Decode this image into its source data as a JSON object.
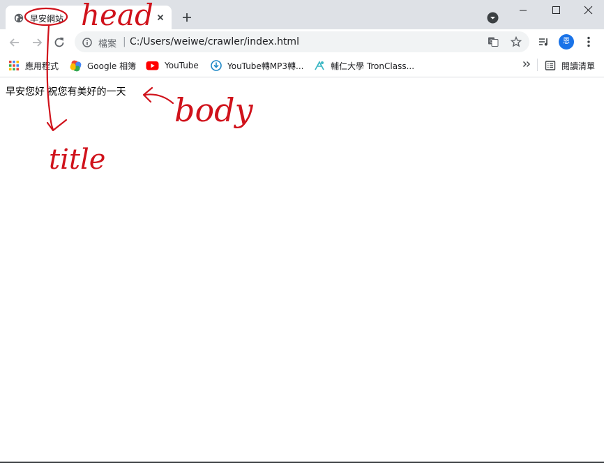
{
  "browser": {
    "tab": {
      "title": "早安網站",
      "favicon": "globe-icon"
    },
    "omnibox": {
      "scheme_label": "檔案",
      "url": "C:/Users/weiwe/crawler/index.html"
    },
    "profile": {
      "initial": "恩"
    },
    "bookmarks": [
      {
        "label": "應用程式",
        "icon": "apps-grid-icon"
      },
      {
        "label": "Google 相簿",
        "icon": "google-photos-icon"
      },
      {
        "label": "YouTube",
        "icon": "youtube-icon"
      },
      {
        "label": "YouTube轉MP3轉...",
        "icon": "download-icon"
      },
      {
        "label": "輔仁大學 TronClass...",
        "icon": "tronclass-icon"
      }
    ],
    "reading_list": "閱讀清單"
  },
  "page": {
    "body_text": "早安您好 祝您有美好的一天"
  },
  "annotations": {
    "head": "head",
    "title": "title",
    "body": "body"
  },
  "colors": {
    "annotation_ink": "#d0121b",
    "profile_blue": "#1a73e8",
    "youtube_red": "#ff0000"
  }
}
